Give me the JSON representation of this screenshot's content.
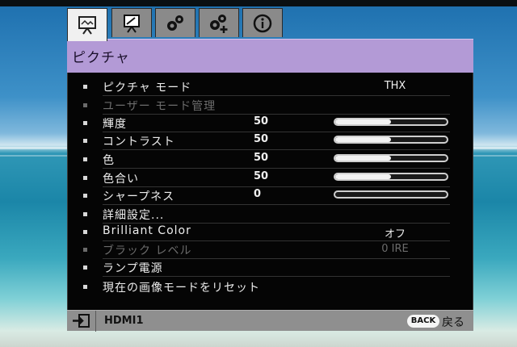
{
  "tabs": [
    {
      "name": "picture-tab",
      "icon": "picture-icon",
      "active": true
    },
    {
      "name": "display-tab",
      "icon": "display-icon",
      "active": false
    },
    {
      "name": "setup-basic-tab",
      "icon": "gears-icon",
      "active": false
    },
    {
      "name": "setup-advanced-tab",
      "icon": "gears-plus-icon",
      "active": false
    },
    {
      "name": "info-tab",
      "icon": "info-icon",
      "active": false
    }
  ],
  "menu": {
    "title": "ピクチャ"
  },
  "items": [
    {
      "label": "ピクチャ モード",
      "value": "THX",
      "type": "text",
      "enabled": true
    },
    {
      "label": "ユーザー モード管理",
      "value": "",
      "type": "none",
      "enabled": false
    },
    {
      "label": "輝度",
      "value": "50",
      "type": "slider",
      "level": 0.5,
      "enabled": true
    },
    {
      "label": "コントラスト",
      "value": "50",
      "type": "slider",
      "level": 0.5,
      "enabled": true
    },
    {
      "label": "色",
      "value": "50",
      "type": "slider",
      "level": 0.5,
      "enabled": true
    },
    {
      "label": "色合い",
      "value": "50",
      "type": "slider",
      "level": 0.5,
      "enabled": true
    },
    {
      "label": "シャープネス",
      "value": "0",
      "type": "slider",
      "level": 0.0,
      "enabled": true
    },
    {
      "label": "詳細設定...",
      "value": "",
      "type": "none",
      "enabled": true
    },
    {
      "label": "Brilliant Color",
      "value": "オフ",
      "type": "text",
      "enabled": true
    },
    {
      "label": "ブラック レベル",
      "value": "0 IRE",
      "type": "text",
      "enabled": false
    },
    {
      "label": "ランプ電源",
      "value": "",
      "type": "none",
      "enabled": true
    },
    {
      "label": "現在の画像モードをリセット",
      "value": "",
      "type": "none",
      "enabled": true
    }
  ],
  "status": {
    "source": "HDMI1",
    "back_button": "BACK",
    "back_label": "戻る"
  },
  "colors": {
    "title_bar": "#b39ad6",
    "status_bar": "#8f8f8f",
    "menu_bg": "#050505"
  }
}
